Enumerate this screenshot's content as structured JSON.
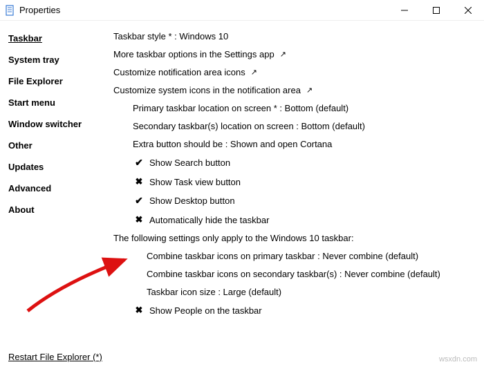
{
  "window": {
    "title": "Properties",
    "minimize": "Minimize",
    "maximize": "Maximize",
    "close": "Close"
  },
  "sidebar": {
    "items": [
      {
        "label": "Taskbar",
        "active": true
      },
      {
        "label": "System tray",
        "active": false
      },
      {
        "label": "File Explorer",
        "active": false
      },
      {
        "label": "Start menu",
        "active": false
      },
      {
        "label": "Window switcher",
        "active": false
      },
      {
        "label": "Other",
        "active": false
      },
      {
        "label": "Updates",
        "active": false
      },
      {
        "label": "Advanced",
        "active": false
      },
      {
        "label": "About",
        "active": false
      }
    ]
  },
  "main": {
    "rows": [
      {
        "text": "Taskbar style * : Windows 10"
      },
      {
        "text": "More taskbar options in the Settings app",
        "link": true
      },
      {
        "text": "Customize notification area icons",
        "link": true
      },
      {
        "text": "Customize system icons in the notification area",
        "link": true
      },
      {
        "text": "Primary taskbar location on screen * : Bottom (default)",
        "indent": 1
      },
      {
        "text": "Secondary taskbar(s) location on screen : Bottom (default)",
        "indent": 1
      },
      {
        "text": "Extra button should be : Shown and open Cortana",
        "indent": 1
      },
      {
        "text": "Show Search button",
        "indent": 1,
        "check": true
      },
      {
        "text": "Show Task view button",
        "indent": 1,
        "check": false
      },
      {
        "text": "Show Desktop button",
        "indent": 1,
        "check": true
      },
      {
        "text": "Automatically hide the taskbar",
        "indent": 1,
        "check": false
      },
      {
        "text": "The following settings only apply to the Windows 10 taskbar:"
      },
      {
        "text": "Combine taskbar icons on primary taskbar : Never combine (default)",
        "indent": 2
      },
      {
        "text": "Combine taskbar icons on secondary taskbar(s) : Never combine (default)",
        "indent": 2
      },
      {
        "text": "Taskbar icon size : Large (default)",
        "indent": 2
      },
      {
        "text": "Show People on the taskbar",
        "indent": 1,
        "check": false
      }
    ]
  },
  "footer": {
    "restart": "Restart File Explorer (*)"
  },
  "watermark": "wsxdn.com"
}
